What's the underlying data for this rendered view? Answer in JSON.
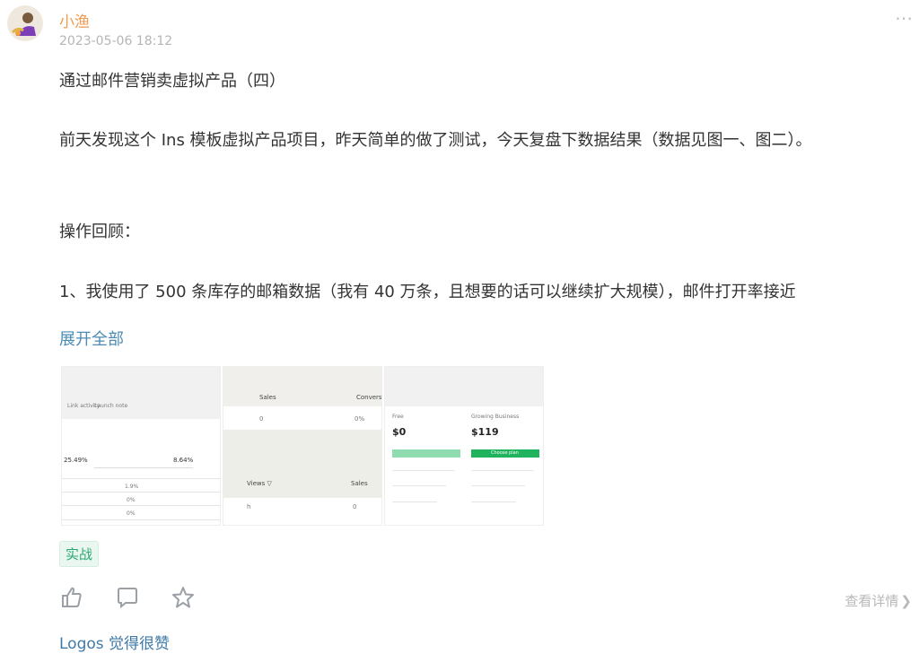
{
  "post": {
    "author": "小渔",
    "timestamp": "2023-05-06 18:12",
    "more_icon": "more-dots",
    "title": "通过邮件营销卖虚拟产品（四）",
    "paragraphs": [
      "前天发现这个 Ins 模板虚拟产品项目，昨天简单的做了测试，今天复盘下数据结果（数据见图一、图二）。",
      "操作回顾：",
      "1、我使用了 500 条库存的邮箱数据（我有 40 万条，且想要的话可以继续扩大规模），邮件打开率接近"
    ],
    "expand_label": "展开全部",
    "tag": "实战",
    "detail_label": "查看详情",
    "likes_text": "Logos 觉得很赞",
    "thumbnails": [
      {
        "name": "thumb-1",
        "labels": [
          "Link activity",
          "Launch note"
        ],
        "stats": [
          "25.49%",
          "8.64%",
          "1.9%",
          "0%",
          "0%"
        ]
      },
      {
        "name": "thumb-2",
        "labels": [
          "Sales",
          "Conversi",
          "0",
          "0%",
          "Views ▽",
          "Sales",
          "h",
          "0"
        ]
      },
      {
        "name": "thumb-3",
        "labels": [
          "Free",
          "$0",
          "Growing Business",
          "$119",
          "Choose plan"
        ]
      }
    ]
  }
}
